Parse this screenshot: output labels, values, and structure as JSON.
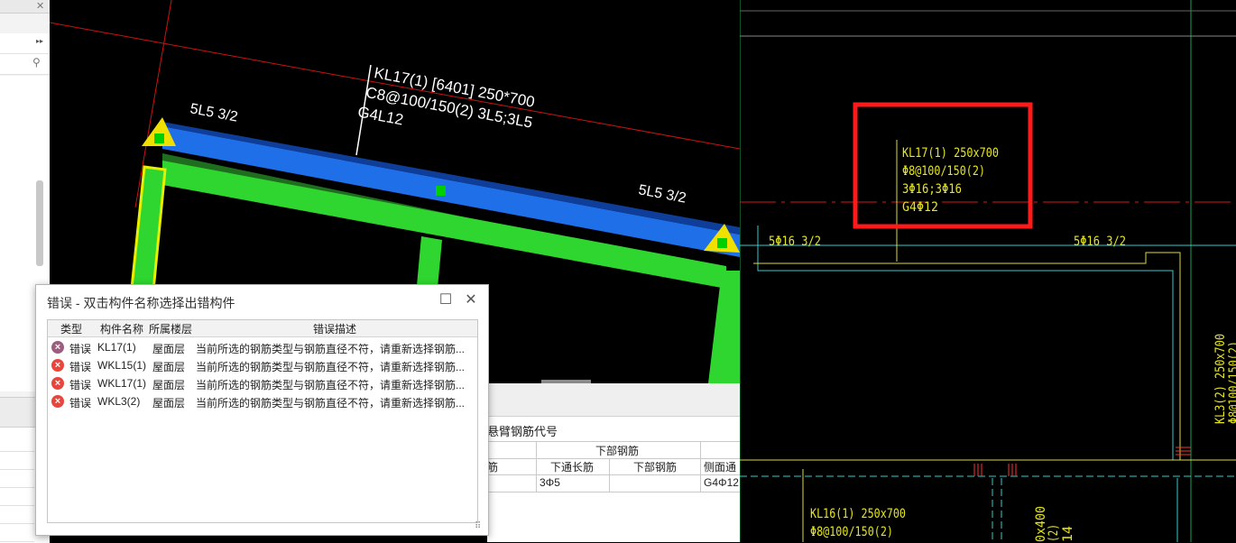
{
  "viewport3d": {
    "beam_label_line1": "KL17(1) [6401] 250*700",
    "beam_label_line2": "C8@100/150(2) 3L5;3L5",
    "beam_label_line3": "G4L12",
    "end_label_left": "5L5 3/2",
    "end_label_right": "5L5 3/2"
  },
  "cad": {
    "highlight_line1": "KL17(1) 250x700",
    "highlight_line2": "Φ8@100/150(2)",
    "highlight_line3": "3Φ16;3Φ16",
    "highlight_line4": "G4Φ12",
    "left_end": "5Φ16 3/2",
    "right_end": "5Φ16 3/2",
    "vertical_label1": "KL3(2) 250x700",
    "vertical_label2": "Φ8@100/150(2)",
    "bottom_line1": "KL16(1) 250x700",
    "bottom_line2": "Φ8@100/150(2)",
    "bottom_vertical1": "0x400",
    "bottom_vertical2": "(2)",
    "bottom_vertical3": "14"
  },
  "bottom_panel": {
    "section_title": "悬臂钢筋代号",
    "header_group": "下部钢筋",
    "col_a": "筋",
    "col_b": "下通长筋",
    "col_c": "下部钢筋",
    "col_d": "侧面通",
    "val_b": "3Φ5",
    "val_d": "G4Φ12"
  },
  "dialog": {
    "title": "错误 - 双击构件名称选择出错构件",
    "maximize": "☐",
    "close": "✕",
    "columns": [
      "类型",
      "构件名称",
      "所属楼层",
      "错误描述"
    ],
    "rows": [
      {
        "type": "错误",
        "name": "KL17(1)",
        "floor": "屋面层",
        "desc": "当前所选的钢筋类型与钢筋直径不符，请重新选择钢筋...",
        "icon_color": "#9c5d7f"
      },
      {
        "type": "错误",
        "name": "WKL15(1)",
        "floor": "屋面层",
        "desc": "当前所选的钢筋类型与钢筋直径不符，请重新选择钢筋...",
        "icon_color": "#e8453c"
      },
      {
        "type": "错误",
        "name": "WKL17(1)",
        "floor": "屋面层",
        "desc": "当前所选的钢筋类型与钢筋直径不符，请重新选择钢筋...",
        "icon_color": "#e8453c"
      },
      {
        "type": "错误",
        "name": "WKL3(2)",
        "floor": "屋面层",
        "desc": "当前所选的钢筋类型与钢筋直径不符，请重新选择钢筋...",
        "icon_color": "#e8453c"
      }
    ]
  },
  "left_panel": {
    "close_glyph": "✕",
    "expand_glyph": "▸▸",
    "search_glyph": "⚲"
  }
}
